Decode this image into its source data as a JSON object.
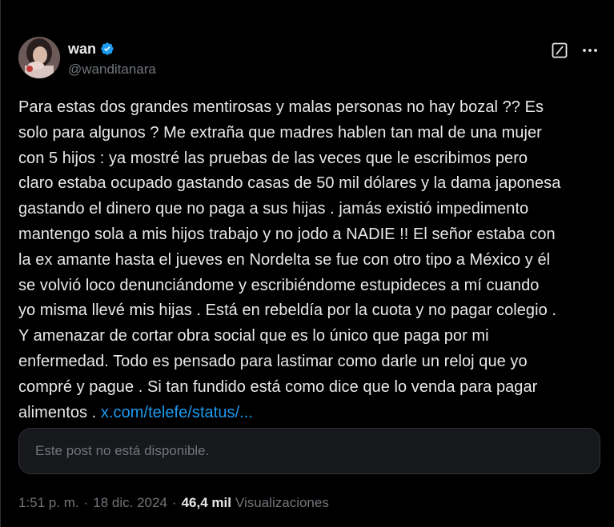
{
  "author": {
    "display_name": "wan",
    "handle": "@wanditanara",
    "verified_icon": "verified-badge-icon",
    "verified_color": "#1d9bf0"
  },
  "post": {
    "text": "Para estas dos grandes mentirosas y malas personas no hay bozal ?? Es\nsolo para algunos ? Me extraña que madres hablen tan mal de una mujer\ncon 5 hijos : ya mostré las pruebas de las veces que le escribimos pero\nclaro estaba ocupado gastando casas de 50 mil dólares y la dama japonesa\ngastando el dinero que no paga a sus hijas .  jamás existió impedimento\nmantengo sola a mis hijos trabajo y no jodo a NADIE !! El señor estaba con\nla ex amante hasta el jueves en Nordelta se fue con otro tipo a México y él\nse volvió loco denunciándome y escribiéndome estupideces a mí cuando\nyo misma llevé mis hijas .  Está en rebeldía por la cuota y no pagar colegio .\nY amenazar de cortar obra social que es lo único que paga por mi\nenfermedad. Todo es pensado para lastimar como darle un reloj que yo\ncompré y pague . Si tan fundido está como dice que lo venda para pagar\nalimentos . ",
    "link_text": "x.com/telefe/status/...",
    "link_color": "#1d9bf0"
  },
  "quoted": {
    "unavailable_text": "Este post no está disponible."
  },
  "meta": {
    "time": "1:51 p. m.",
    "separator": "·",
    "date": "18 dic. 2024",
    "views_count": "46,4 mil",
    "views_label": "Visualizaciones"
  },
  "icons": {
    "grok": "grok-icon",
    "more": "more-options-icon"
  }
}
